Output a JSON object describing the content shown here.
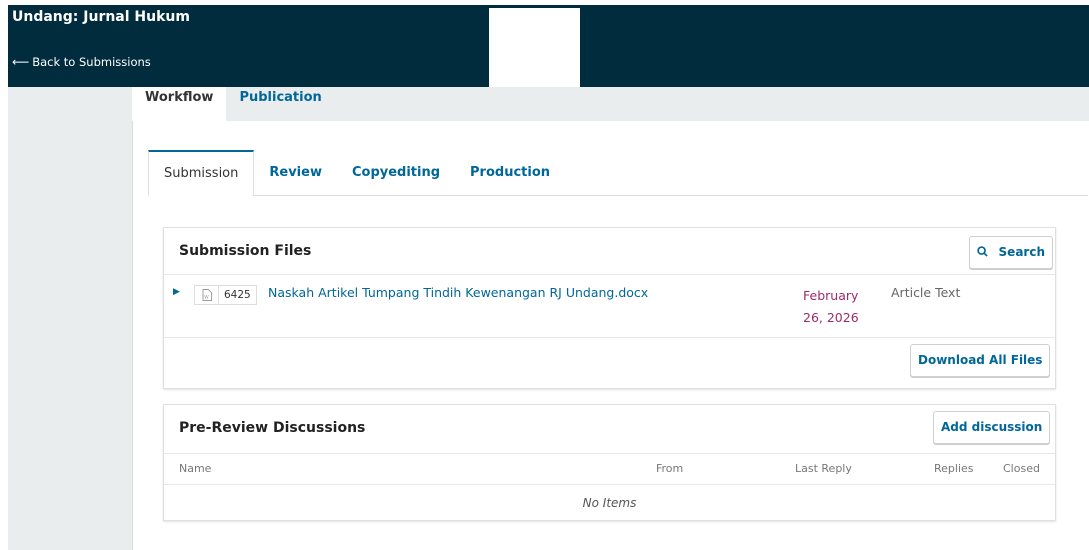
{
  "header": {
    "journal_title": "Undang: Jurnal Hukum",
    "back_arrow": "⟵",
    "back_label": "Back to Submissions"
  },
  "top_tabs": [
    {
      "label": "Workflow",
      "active": true
    },
    {
      "label": "Publication",
      "active": false
    }
  ],
  "stage_tabs": [
    {
      "label": "Submission",
      "active": true
    },
    {
      "label": "Review",
      "active": false
    },
    {
      "label": "Copyediting",
      "active": false
    },
    {
      "label": "Production",
      "active": false
    }
  ],
  "submission_files": {
    "title": "Submission Files",
    "search_label": "Search",
    "search_icon": "search-icon",
    "files": [
      {
        "id": "6425",
        "name": "Naskah Artikel Tumpang Tindih Kewenangan RJ Undang.docx",
        "date": "February 26, 2026",
        "type": "Article Text",
        "icon": "word-document-icon"
      }
    ],
    "download_all_label": "Download All Files"
  },
  "discussions": {
    "title": "Pre-Review Discussions",
    "add_label": "Add discussion",
    "columns": [
      "Name",
      "From",
      "Last Reply",
      "Replies",
      "Closed"
    ],
    "empty_text": "No Items"
  },
  "colors": {
    "header_bg": "#002c3e",
    "link": "#006798",
    "date": "#9c2b6a",
    "page_bg": "#eaedee"
  }
}
